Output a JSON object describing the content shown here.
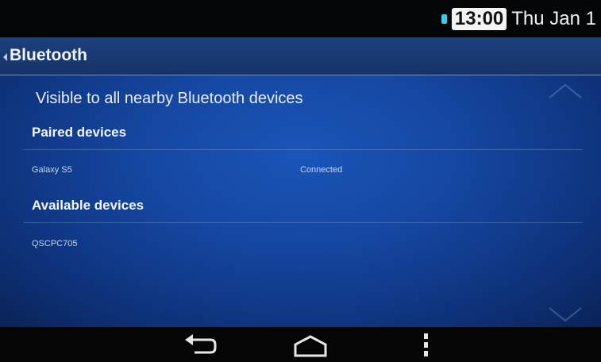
{
  "status_bar": {
    "time": "13:00",
    "date": "Thu Jan 1",
    "indicator_color": "#41c8e6"
  },
  "header": {
    "title": "Bluetooth"
  },
  "visibility": {
    "text": "Visible to all nearby Bluetooth devices"
  },
  "paired": {
    "header": "Paired devices",
    "devices": [
      {
        "name": "Galaxy S5",
        "status": "Connected"
      }
    ]
  },
  "available": {
    "header": "Available devices",
    "devices": [
      {
        "name": "QSCPC705"
      }
    ]
  },
  "nav": {
    "icons": [
      "back-icon",
      "home-icon",
      "menu-icon"
    ]
  },
  "colors": {
    "panel_blue": "#1648a4",
    "status_bar_bg": "#050608",
    "nav_bar_bg": "#050506"
  }
}
